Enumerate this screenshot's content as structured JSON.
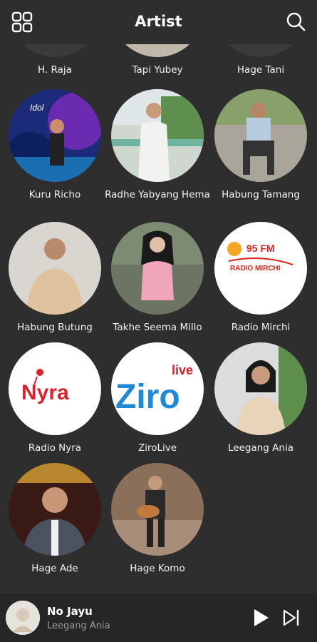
{
  "header": {
    "title": "Artist",
    "menu_icon": "grid-icon",
    "search_icon": "search-icon"
  },
  "artists": [
    {
      "name": "H. Raja"
    },
    {
      "name": "Tapi Yubey"
    },
    {
      "name": "Hage Tani"
    },
    {
      "name": "Kuru Richo"
    },
    {
      "name": "Radhe Yabyang Hema"
    },
    {
      "name": "Habung Tamang"
    },
    {
      "name": "Habung Butung"
    },
    {
      "name": "Takhe Seema Millo"
    },
    {
      "name": "Radio Mirchi",
      "logo_text": "95 FM",
      "logo_sub": "RADIO MIRCHI"
    },
    {
      "name": "Radio Nyra",
      "logo_text": "Nyra"
    },
    {
      "name": "ZiroLive",
      "logo_text": "Ziro",
      "logo_sub": "live"
    },
    {
      "name": "Leegang Ania"
    },
    {
      "name": "Hage Ade"
    },
    {
      "name": "Hage Komo"
    }
  ],
  "player": {
    "song": "No Jayu",
    "artist": "Leegang Ania",
    "play_icon": "play-icon",
    "next_icon": "skip-next-icon"
  },
  "colors": {
    "background": "#2e2e2e",
    "player_background": "#262626",
    "text": "#ffffff",
    "muted": "#9a9a9a"
  }
}
